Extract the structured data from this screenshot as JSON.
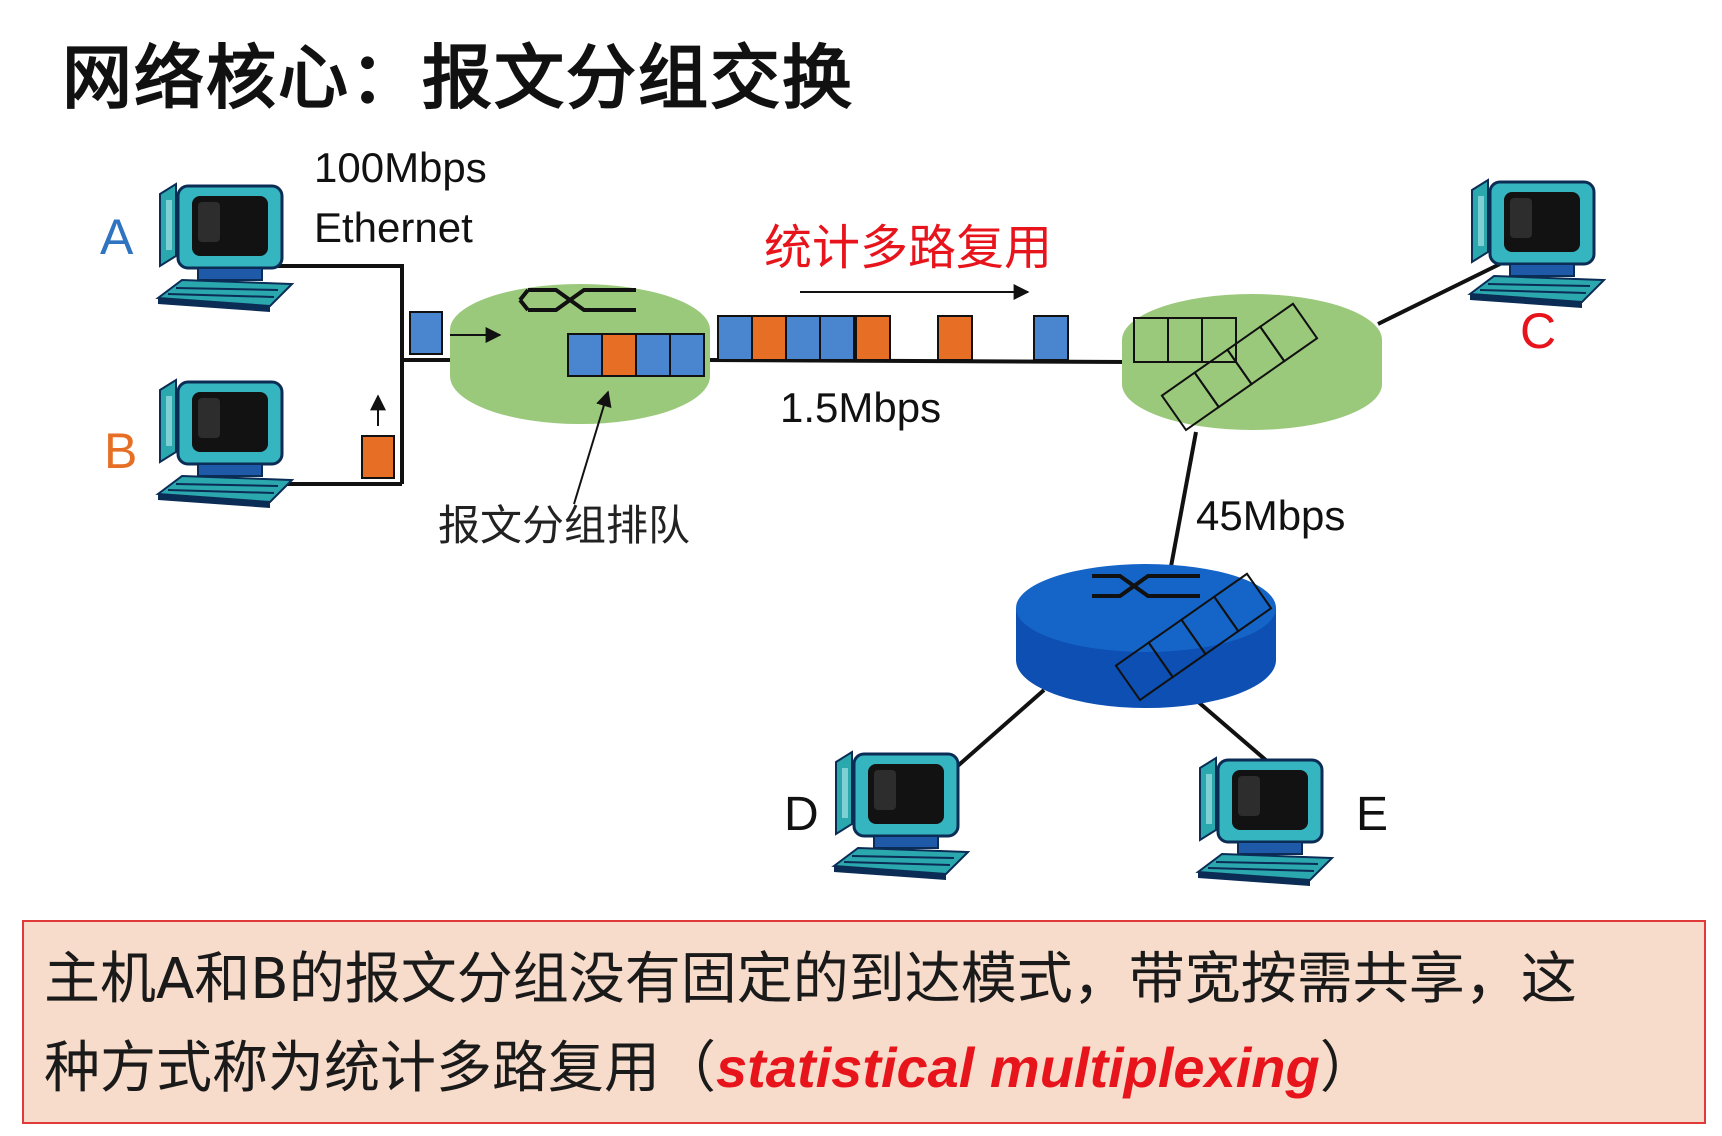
{
  "title": "网络核心：报文分组交换",
  "hosts": {
    "a": "A",
    "b": "B",
    "c": "C",
    "d": "D",
    "e": "E"
  },
  "links": {
    "ethernet_rate": "100Mbps",
    "ethernet_name": "Ethernet",
    "core_rate": "1.5Mbps",
    "lower_rate": "45Mbps"
  },
  "labels": {
    "stat_mux": "统计多路复用",
    "queue": "报文分组排队"
  },
  "colors": {
    "host_a": "#2e74c0",
    "host_b": "#e66e25",
    "host_c": "#e8141c",
    "router_green": "#9bc97c",
    "router_blue": "#0d4fb3",
    "packet_blue": "#4a86d0",
    "packet_orange": "#e66e25",
    "note_bg": "#f8dccb",
    "note_border": "#e03a3a",
    "emphasis": "#e8141c"
  },
  "note": {
    "line1": "主机A和B的报文分组没有固定的到达模式，带宽按需共享，这",
    "line2_pre": "种方式称为统计多路复用（",
    "line2_em": "statistical multiplexing",
    "line2_post": "）"
  }
}
